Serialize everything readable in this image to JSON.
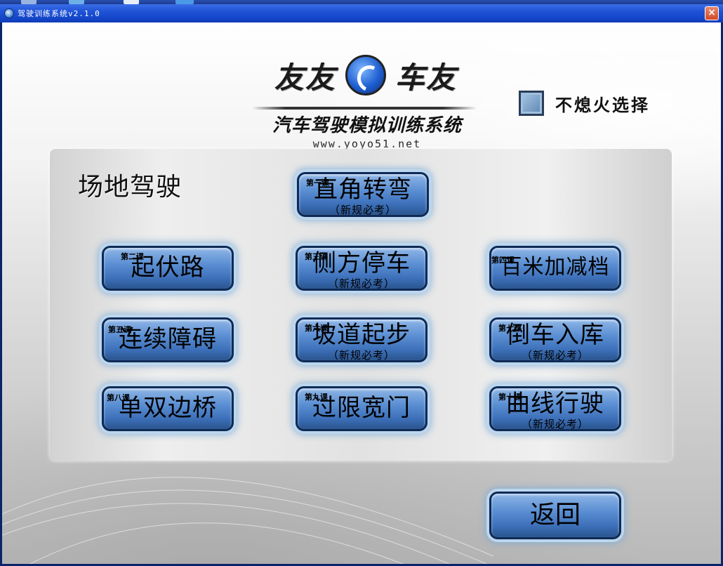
{
  "window": {
    "title": "驾驶训练系统v2.1.0",
    "close_label": "×"
  },
  "logo": {
    "word_left": "友友",
    "word_right": "车友",
    "subtitle": "汽车驾驶模拟训练系统",
    "url": "www.yoyo51.net"
  },
  "option": {
    "no_stall_label": "不熄火选择",
    "no_stall_checked": false
  },
  "section": {
    "title": "场地驾驶"
  },
  "lessons": [
    {
      "num": "第一课",
      "name": "直角转弯",
      "note": "（新规必考）"
    },
    {
      "num": "第二课",
      "name": "起伏路",
      "note": ""
    },
    {
      "num": "第三课",
      "name": "侧方停车",
      "note": "（新规必考）"
    },
    {
      "num": "第四课",
      "name": "百米加减档",
      "note": ""
    },
    {
      "num": "第五课",
      "name": "连续障碍",
      "note": ""
    },
    {
      "num": "第六课",
      "name": "坡道起步",
      "note": "（新规必考）"
    },
    {
      "num": "第七课",
      "name": "倒车入库",
      "note": "（新规必考）"
    },
    {
      "num": "第八课",
      "name": "单双边桥",
      "note": ""
    },
    {
      "num": "第九课",
      "name": "过限宽门",
      "note": ""
    },
    {
      "num": "第十课",
      "name": "曲线行驶",
      "note": "（新规必考）"
    }
  ],
  "back_label": "返回"
}
